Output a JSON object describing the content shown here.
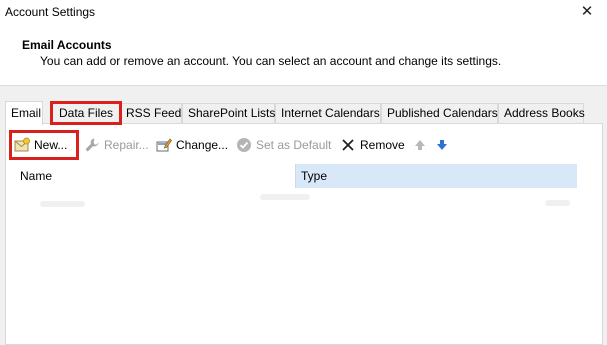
{
  "window": {
    "title": "Account Settings",
    "close_glyph": "✕"
  },
  "header": {
    "title": "Email Accounts",
    "description": "You can add or remove an account. You can select an account and change its settings."
  },
  "tabs": [
    {
      "label": "Email",
      "active": true,
      "highlighted": false
    },
    {
      "label": "Data Files",
      "active": false,
      "highlighted": true
    },
    {
      "label": "RSS Feeds",
      "active": false,
      "highlighted": false
    },
    {
      "label": "SharePoint Lists",
      "active": false,
      "highlighted": false
    },
    {
      "label": "Internet Calendars",
      "active": false,
      "highlighted": false
    },
    {
      "label": "Published Calendars",
      "active": false,
      "highlighted": false
    },
    {
      "label": "Address Books",
      "active": false,
      "highlighted": false
    }
  ],
  "toolbar": {
    "new_label": "New...",
    "repair_label": "Repair...",
    "change_label": "Change...",
    "set_default_label": "Set as Default",
    "remove_label": "Remove",
    "icons": {
      "new": "envelope-new-icon",
      "repair": "wrench-icon",
      "change": "edit-icon",
      "set_default": "check-circle-icon",
      "remove": "x-icon",
      "move_up": "arrow-up-icon",
      "move_down": "arrow-down-icon"
    }
  },
  "list": {
    "columns": [
      "Name",
      "Type"
    ]
  },
  "colors": {
    "highlight": "#d9201c",
    "type_header_bg": "#d9e8f8",
    "arrow_down": "#2f6fd6",
    "arrow_up": "#b8b8b8"
  }
}
